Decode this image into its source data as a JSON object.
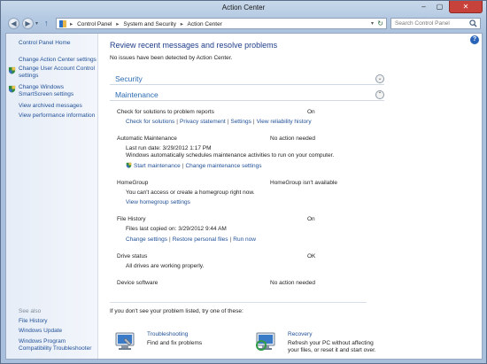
{
  "window": {
    "title": "Action Center",
    "minimize": "‒",
    "maximize": "▢",
    "close": "✕"
  },
  "nav": {
    "back": "◀",
    "forward": "▶",
    "history": "▾",
    "up": "↑",
    "breadcrumb": [
      "Control Panel",
      "System and Security",
      "Action Center"
    ],
    "breadcrumb_separator": "▸",
    "address_dropdown": "▾",
    "refresh": "↻",
    "search_placeholder": "Search Control Panel"
  },
  "sidebar": {
    "items": [
      {
        "label": "Control Panel Home",
        "icon": null
      },
      {
        "label": "Change Action Center settings",
        "icon": null
      },
      {
        "label": "Change User Account Control settings",
        "icon": "uac-shield-icon"
      },
      {
        "label": "Change Windows SmartScreen settings",
        "icon": "uac-shield-icon"
      },
      {
        "label": "View archived messages",
        "icon": null
      },
      {
        "label": "View performance information",
        "icon": null
      }
    ],
    "see_also": "See also",
    "see_also_items": [
      "File History",
      "Windows Update",
      "Windows Program Compatibility Troubleshooter"
    ]
  },
  "main": {
    "heading": "Review recent messages and resolve problems",
    "subheading": "No issues have been detected by Action Center.",
    "security": {
      "title": "Security",
      "chevron": "⌄"
    },
    "maintenance": {
      "title": "Maintenance",
      "chevron": "⌃"
    },
    "check_solutions": {
      "label": "Check for solutions to problem reports",
      "status": "On",
      "links": [
        "Check for solutions",
        "Privacy statement",
        "Settings",
        "View reliability history"
      ]
    },
    "auto_maintenance": {
      "label": "Automatic Maintenance",
      "status": "No action needed",
      "last_run": "Last run date: 3/29/2012 1:17 PM",
      "description": "Windows automatically schedules maintenance activities to run on your computer.",
      "links": [
        "Start maintenance",
        "Change maintenance settings"
      ]
    },
    "homegroup": {
      "label": "HomeGroup",
      "status": "HomeGroup isn't available",
      "message": "You can't access or create a homegroup right now.",
      "link": "View homegroup settings"
    },
    "file_history": {
      "label": "File History",
      "status": "On",
      "last_copied": "Files last copied on: 3/29/2012 9:44 AM",
      "links": [
        "Change settings",
        "Restore personal files",
        "Run now"
      ]
    },
    "drive_status": {
      "label": "Drive status",
      "status": "OK",
      "message": "All drives are working properly."
    },
    "device_software": {
      "label": "Device software",
      "status": "No action needed"
    },
    "link_separator": "|",
    "footer": "If you don't see your problem listed, try one of these:",
    "troubleshooting": {
      "title": "Troubleshooting",
      "desc": "Find and fix problems"
    },
    "recovery": {
      "title": "Recovery",
      "desc": [
        "Refresh your PC without affecting",
        "your files, or reset it and start over."
      ]
    }
  },
  "help": "?",
  "colors": {
    "link": "#1f4f97",
    "heading": "#1e3d8a",
    "section": "#2b6bb3",
    "close": "#c7423a"
  }
}
